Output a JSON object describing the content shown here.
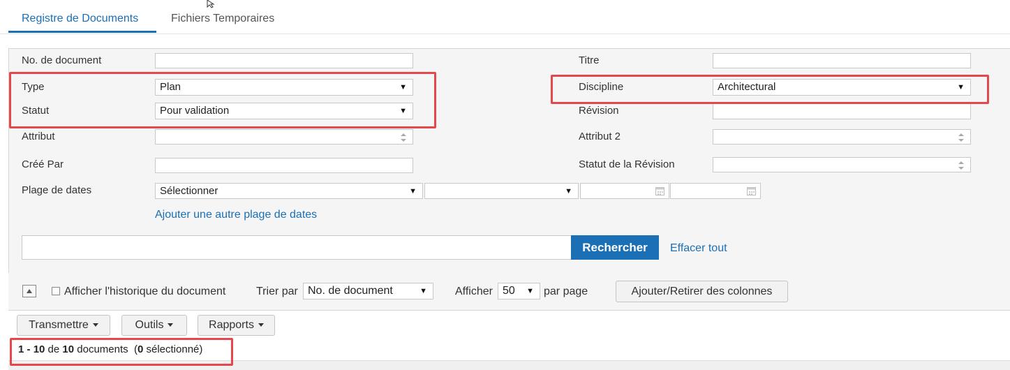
{
  "tabs": {
    "registry": "Registre de Documents",
    "temp": "Fichiers Temporaires"
  },
  "form": {
    "doc_no_label": "No. de document",
    "title_label": "Titre",
    "type_label": "Type",
    "type_value": "Plan",
    "discipline_label": "Discipline",
    "discipline_value": "Architectural",
    "status_label": "Statut",
    "status_value": "Pour validation",
    "revision_label": "Révision",
    "attribute_label": "Attribut",
    "attribute2_label": "Attribut 2",
    "created_by_label": "Créé Par",
    "revision_status_label": "Statut de la Révision",
    "date_range_label": "Plage de dates",
    "date_range_value": "Sélectionner",
    "add_date_range_link": "Ajouter une autre plage de dates"
  },
  "search": {
    "button": "Rechercher",
    "clear": "Effacer tout"
  },
  "options": {
    "show_history": "Afficher l'historique du document",
    "sort_label": "Trier par",
    "sort_value": "No. de document",
    "show_label": "Afficher",
    "show_value": "50",
    "per_page": "par page",
    "columns_button": "Ajouter/Retirer des colonnes"
  },
  "actions": {
    "transmit": "Transmettre",
    "tools": "Outils",
    "reports": "Rapports"
  },
  "results": {
    "from": "1",
    "to": "10",
    "of": "de",
    "total": "10",
    "docs": "documents",
    "selected": "0",
    "selected_label": "sélectionné"
  },
  "icons": {
    "collapse": "collapse-up-icon",
    "calendar": "calendar-icon",
    "cursor": "mouse-cursor-icon"
  }
}
